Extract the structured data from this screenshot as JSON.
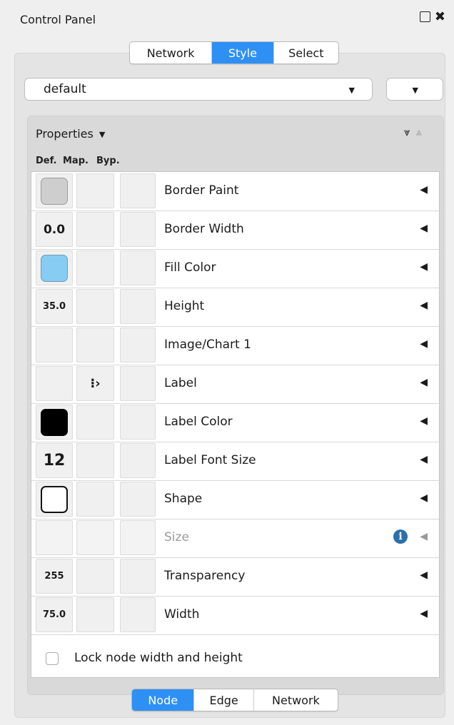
{
  "window": {
    "title": "Control Panel"
  },
  "top_tabs": [
    {
      "label": "Network",
      "active": false
    },
    {
      "label": "Style",
      "active": true
    },
    {
      "label": "Select",
      "active": false
    }
  ],
  "style_selector": {
    "value": "default"
  },
  "properties": {
    "header": "Properties",
    "columns": {
      "def": "Def.",
      "map": "Map.",
      "byp": "Byp."
    },
    "rows": [
      {
        "name": "Border Paint",
        "default": "swatch-gray"
      },
      {
        "name": "Border Width",
        "default": "0.0"
      },
      {
        "name": "Fill Color",
        "default": "swatch-lightblue"
      },
      {
        "name": "Height",
        "default": "35.0"
      },
      {
        "name": "Image/Chart 1",
        "default": ""
      },
      {
        "name": "Label",
        "default": "",
        "mapping": "passthrough-mapping-icon"
      },
      {
        "name": "Label Color",
        "default": "swatch-black"
      },
      {
        "name": "Label Font Size",
        "default": "12"
      },
      {
        "name": "Shape",
        "default": "shape-rectangle"
      },
      {
        "name": "Size",
        "default": "",
        "disabled": true
      },
      {
        "name": "Transparency",
        "default": "255"
      },
      {
        "name": "Width",
        "default": "75.0"
      }
    ],
    "lock_label": "Lock node width and height",
    "lock_checked": false
  },
  "bottom_tabs": [
    {
      "label": "Node",
      "active": true
    },
    {
      "label": "Edge",
      "active": false
    },
    {
      "label": "Network",
      "active": false
    }
  ],
  "colors": {
    "accent": "#2e90f5",
    "fill_color": "#87ccf3",
    "border_paint": "#cecece",
    "label_color": "#000000",
    "info": "#2d6fa8"
  }
}
